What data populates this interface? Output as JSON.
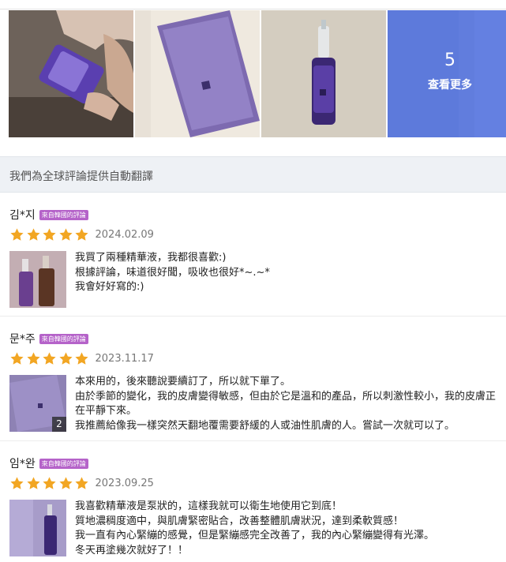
{
  "gallery": {
    "photos": [
      {
        "label": "product-photo-1"
      },
      {
        "label": "product-photo-2"
      },
      {
        "label": "product-photo-3"
      }
    ],
    "more_count": "5",
    "more_label": "查看更多"
  },
  "banner": {
    "text": "我們為全球評論提供自動翻譯"
  },
  "reviews": [
    {
      "user": "김*지",
      "badge": "來自韓國的評論",
      "rating": 5,
      "date": "2024.02.09",
      "lines": [
        "我買了兩種精華液，我都很喜歡:)",
        "根據評論，味道很好聞，吸收也很好*~.~*",
        "我會好好寫的:)"
      ],
      "thumb_count": ""
    },
    {
      "user": "문*주",
      "badge": "來自韓國的評論",
      "rating": 5,
      "date": "2023.11.17",
      "lines": [
        "本來用的，後來聽說要續訂了，所以就下單了。",
        "由於季節的變化，我的皮膚變得敏感，但由於它是溫和的產品，所以刺激性較小，我的皮膚正在平靜下來。",
        "我推薦給像我一樣突然天翻地覆需要舒緩的人或油性肌膚的人。嘗試一次就可以了。"
      ],
      "thumb_count": "2"
    },
    {
      "user": "임*완",
      "badge": "來自韓國的評論",
      "rating": 5,
      "date": "2023.09.25",
      "lines": [
        "我喜歡精華液是泵狀的，這樣我就可以衛生地使用它到底！",
        "質地濃稠度適中，與肌膚緊密貼合，改善整體肌膚狀況，達到柔軟質感！",
        "我一直有內心緊繃的感覺，但是緊繃感完全改善了，我的內心緊繃變得有光澤。",
        "冬天再塗幾次就好了！！"
      ],
      "thumb_count": ""
    }
  ],
  "colors": {
    "star": "#f2a623",
    "badge": "#b563c9",
    "more_overlay": "#5878e6",
    "banner_bg": "#eef1f5"
  }
}
